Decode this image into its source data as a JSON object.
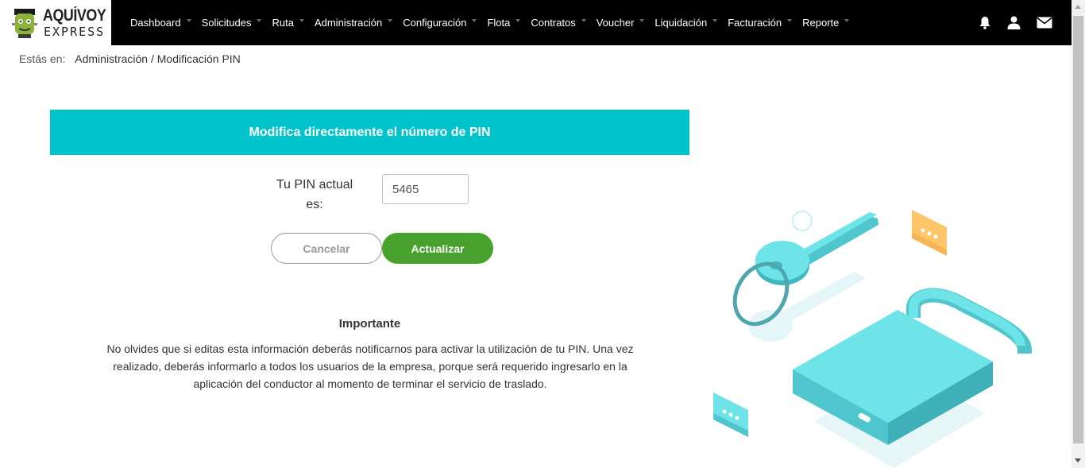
{
  "brand": {
    "line1": "AQUÍVOY",
    "line2": "EXPRESS"
  },
  "nav": {
    "items": [
      {
        "label": "Dashboard"
      },
      {
        "label": "Solicitudes"
      },
      {
        "label": "Ruta"
      },
      {
        "label": "Administración"
      },
      {
        "label": "Configuración"
      },
      {
        "label": "Flota"
      },
      {
        "label": "Contratos"
      },
      {
        "label": "Voucher"
      },
      {
        "label": "Liquidación"
      },
      {
        "label": "Facturación"
      },
      {
        "label": "Reporte"
      }
    ],
    "icons": [
      "bell-icon",
      "user-icon",
      "envelope-icon"
    ]
  },
  "breadcrumb": {
    "prefix": "Estás en:",
    "path": "Administración / Modificación PIN"
  },
  "banner": {
    "title": "Modifica directamente el número de PIN"
  },
  "pin": {
    "label": "Tu PIN actual es:",
    "value": "5465"
  },
  "buttons": {
    "cancel": "Cancelar",
    "update": "Actualizar"
  },
  "important": {
    "title": "Importante",
    "text": "No olvides que si editas esta información deberás notificarnos para activar la utilización de tu PIN. Una vez realizado, deberás informarlo a todos los usuarios de la empresa, porque será requerido ingresarlo en la aplicación del conductor al momento de terminar el servicio de traslado."
  },
  "colors": {
    "topbar": "#000000",
    "banner": "#00c3cb",
    "update_button": "#47a12c",
    "illustration_teal": "#6ee3e8",
    "illustration_orange": "#ffc56b"
  }
}
